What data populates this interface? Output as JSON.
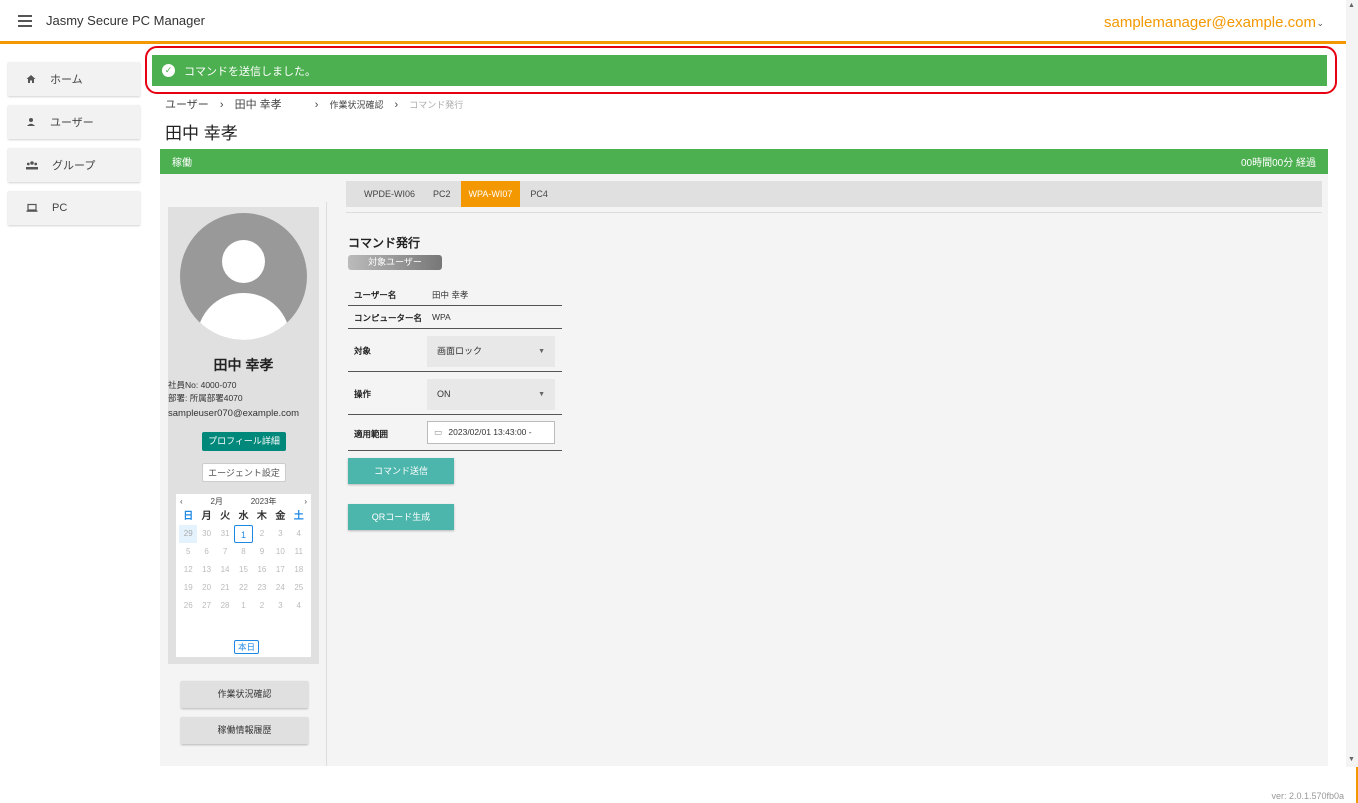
{
  "app": {
    "title": "Jasmy Secure PC Manager",
    "user_email": "samplemanager@example.com",
    "caret": "⌄",
    "version": "ver: 2.0.1.570fb0a"
  },
  "colors": {
    "accent": "#f39800",
    "success": "#4caf50",
    "teal": "#00897b",
    "action": "#4db6ac",
    "highlight": "#e60012"
  },
  "sidebar": {
    "items": [
      {
        "label": "ホーム",
        "icon": "home-icon"
      },
      {
        "label": "ユーザー",
        "icon": "user-icon"
      },
      {
        "label": "グループ",
        "icon": "group-icon"
      },
      {
        "label": "PC",
        "icon": "laptop-icon"
      }
    ]
  },
  "alert": {
    "message": "コマンドを送信しました。",
    "icon": "check-circle-icon"
  },
  "breadcrumb": {
    "items": [
      "ユーザー",
      "田中 幸孝",
      "作業状況確認",
      "コマンド発行"
    ],
    "separator": "›"
  },
  "page": {
    "title": "田中 幸孝"
  },
  "status": {
    "label": "稼働",
    "elapsed": "00時間00分 経過"
  },
  "tabs": {
    "items": [
      "WPDE-WI06",
      "PC2",
      "WPA-WI07",
      "PC4"
    ],
    "active_index": 2
  },
  "profile": {
    "name": "田中 幸孝",
    "employee_no": "社員No: 4000-070",
    "department": "部署: 所属部署4070",
    "email": "sampleuser070@example.com",
    "profile_button": "プロフィール詳細",
    "agent_button": "エージェント設定"
  },
  "calendar": {
    "prev": "‹",
    "next": "›",
    "month": "2月",
    "year": "2023年",
    "weekdays": [
      "日",
      "月",
      "火",
      "水",
      "木",
      "金",
      "土"
    ],
    "days": [
      "29",
      "30",
      "31",
      "1",
      "2",
      "3",
      "4",
      "5",
      "6",
      "7",
      "8",
      "9",
      "10",
      "11",
      "12",
      "13",
      "14",
      "15",
      "16",
      "17",
      "18",
      "19",
      "20",
      "21",
      "22",
      "23",
      "24",
      "25",
      "26",
      "27",
      "28",
      "1",
      "2",
      "3",
      "4"
    ],
    "today_label": "本日"
  },
  "side_buttons": {
    "work_status": "作業状況確認",
    "operation_history": "稼働情報履歴"
  },
  "command": {
    "title": "コマンド発行",
    "target_chip": "対象ユーザー",
    "user_label": "ユーザー名",
    "user_value": "田中 幸孝",
    "computer_label": "コンピューター名",
    "computer_value": "WPA",
    "target_label": "対象",
    "target_value": "画面ロック",
    "operation_label": "操作",
    "operation_value": "ON",
    "range_label": "適用範囲",
    "range_value": "2023/02/01 13:43:00 -",
    "send_button": "コマンド送信",
    "qr_button": "QRコード生成"
  }
}
